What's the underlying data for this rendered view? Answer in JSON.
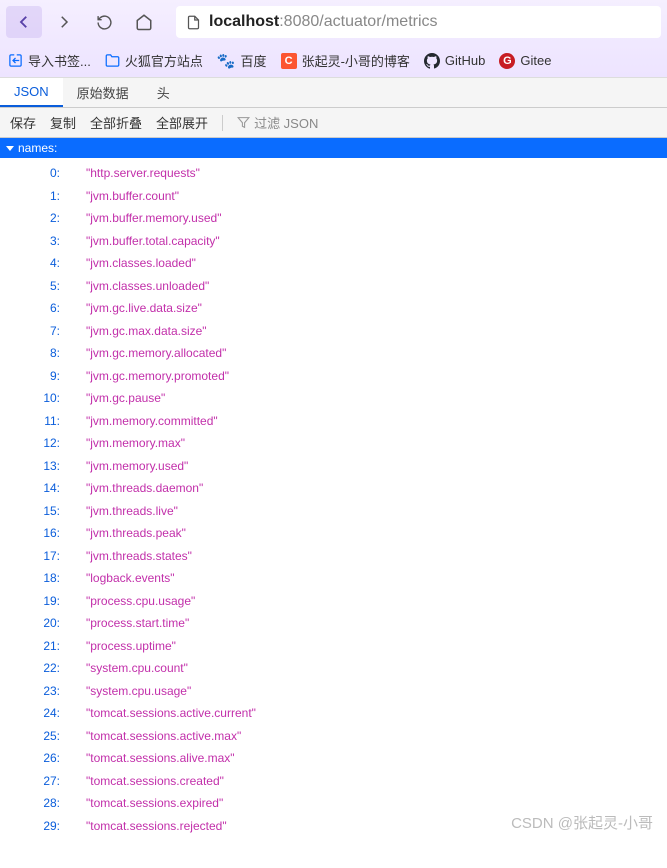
{
  "url": {
    "host": "localhost",
    "rest": ":8080/actuator/metrics"
  },
  "bookmarks": [
    {
      "label": "导入书签..."
    },
    {
      "label": "火狐官方站点"
    },
    {
      "label": "百度"
    },
    {
      "label": "张起灵-小哥的博客"
    },
    {
      "label": "GitHub"
    },
    {
      "label": "Gitee"
    }
  ],
  "tabs": [
    {
      "label": "JSON",
      "active": true
    },
    {
      "label": "原始数据"
    },
    {
      "label": "头"
    }
  ],
  "toolbar": {
    "save": "保存",
    "copy": "复制",
    "collapse_all": "全部折叠",
    "expand_all": "全部展开",
    "filter_placeholder": "过滤 JSON"
  },
  "json": {
    "key": "names:",
    "items": [
      "http.server.requests",
      "jvm.buffer.count",
      "jvm.buffer.memory.used",
      "jvm.buffer.total.capacity",
      "jvm.classes.loaded",
      "jvm.classes.unloaded",
      "jvm.gc.live.data.size",
      "jvm.gc.max.data.size",
      "jvm.gc.memory.allocated",
      "jvm.gc.memory.promoted",
      "jvm.gc.pause",
      "jvm.memory.committed",
      "jvm.memory.max",
      "jvm.memory.used",
      "jvm.threads.daemon",
      "jvm.threads.live",
      "jvm.threads.peak",
      "jvm.threads.states",
      "logback.events",
      "process.cpu.usage",
      "process.start.time",
      "process.uptime",
      "system.cpu.count",
      "system.cpu.usage",
      "tomcat.sessions.active.current",
      "tomcat.sessions.active.max",
      "tomcat.sessions.alive.max",
      "tomcat.sessions.created",
      "tomcat.sessions.expired",
      "tomcat.sessions.rejected"
    ]
  },
  "watermark": "CSDN @张起灵-小哥"
}
